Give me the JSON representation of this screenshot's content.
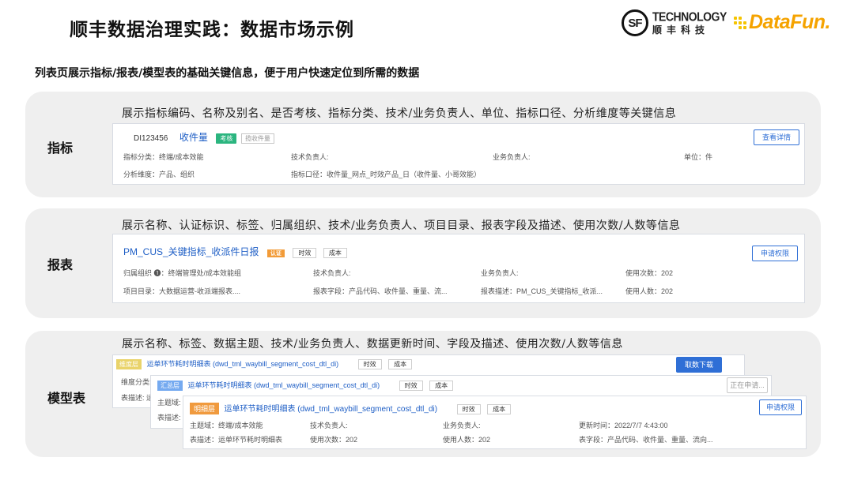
{
  "header": {
    "title": "顺丰数据治理实践：数据市场示例",
    "sf_logo_mark": "SF",
    "sf_logo_en": "TECHNOLOGY",
    "sf_logo_cn": "顺丰科技",
    "datafun_logo": "DataFun."
  },
  "subtitle": "列表页展示指标/报表/模型表的基础关键信息，便于用户快速定位到所需的数据",
  "metric": {
    "label": "指标",
    "desc": "展示指标编码、名称及别名、是否考核、指标分类、技术/业务负责人、单位、指标口径、分析维度等关键信息",
    "code": "DI123456",
    "name": "收件量",
    "tag_assess": "考核",
    "alias": "揽收件量",
    "button": "查看详情",
    "category": "指标分类：终端/成本效能",
    "tech_owner": "技术负责人:",
    "biz_owner": "业务负责人:",
    "unit": "单位：件",
    "dimension": "分析维度：产品、组织",
    "caliber": "指标口径：收件量_网点_时效产品_日（收件量、小哥效能）"
  },
  "report": {
    "label": "报表",
    "desc": "展示名称、认证标识、标签、归属组织、技术/业务负责人、项目目录、报表字段及描述、使用次数/人数等信息",
    "name": "PM_CUS_关键指标_收派件日报",
    "cert_badge": "认证",
    "tags": [
      "时效",
      "成本"
    ],
    "button": "申请权限",
    "org": "归属组织 ❶：终端管理处/成本效能组",
    "tech_owner": "技术负责人:",
    "biz_owner": "业务负责人:",
    "usage_count": "使用次数：202",
    "project": "项目目录：大数据运营-收派端报表....",
    "fields": "报表字段：产品代码、收件量、重量、流...",
    "report_desc": "报表描述：PM_CUS_关键指标_收派...",
    "user_count": "使用人数：202"
  },
  "model": {
    "label": "模型表",
    "desc": "展示名称、标签、数据主题、技术/业务负责人、数据更新时间、字段及描述、使用次数/人数等信息",
    "cards": [
      {
        "layer": "维度层",
        "name": "运单环节耗时明细表 (dwd_tml_waybill_segment_cost_dtl_di)",
        "tags": [
          "时效",
          "成本"
        ],
        "button": "取数下载",
        "line1": "维度分类:",
        "line2": "表描述: 运"
      },
      {
        "layer": "汇总层",
        "name": "运单环节耗时明细表 (dwd_tml_waybill_segment_cost_dtl_di)",
        "tags": [
          "时效",
          "成本"
        ],
        "button": "正在申请...",
        "line1": "主题域:",
        "line2": "表描述:"
      },
      {
        "layer": "明细层",
        "name": "运单环节耗时明细表 (dwd_tml_waybill_segment_cost_dtl_di)",
        "tags": [
          "时效",
          "成本"
        ],
        "button": "申请权限",
        "subject": "主题域：终端/成本效能",
        "tech_owner": "技术负责人:",
        "biz_owner": "业务负责人:",
        "update_time": "更新时间：2022/7/7 4:43:00",
        "table_desc": "表描述：运单环节耗时明细表",
        "usage_count": "使用次数：202",
        "user_count": "使用人数：202",
        "fields": "表字段：产品代码、收件量、重量、流向..."
      }
    ]
  }
}
